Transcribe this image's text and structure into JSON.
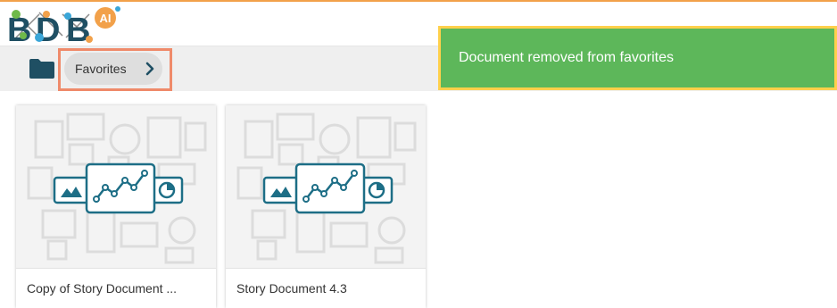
{
  "app": {
    "logo_text": "BDB",
    "logo_badge": "AI"
  },
  "breadcrumb": {
    "label": "Favorites"
  },
  "toast": {
    "message": "Document removed from favorites",
    "color": "#5db75a",
    "highlight_color": "#ffd04b"
  },
  "documents": [
    {
      "title": "Copy of Story Document ..."
    },
    {
      "title": "Story Document 4.3"
    }
  ],
  "colors": {
    "brand_dark": "#1f4f63",
    "accent_orange": "#f2a14a",
    "breadcrumb_highlight": "#ef8a6a",
    "icon_teal": "#1d6e86"
  }
}
